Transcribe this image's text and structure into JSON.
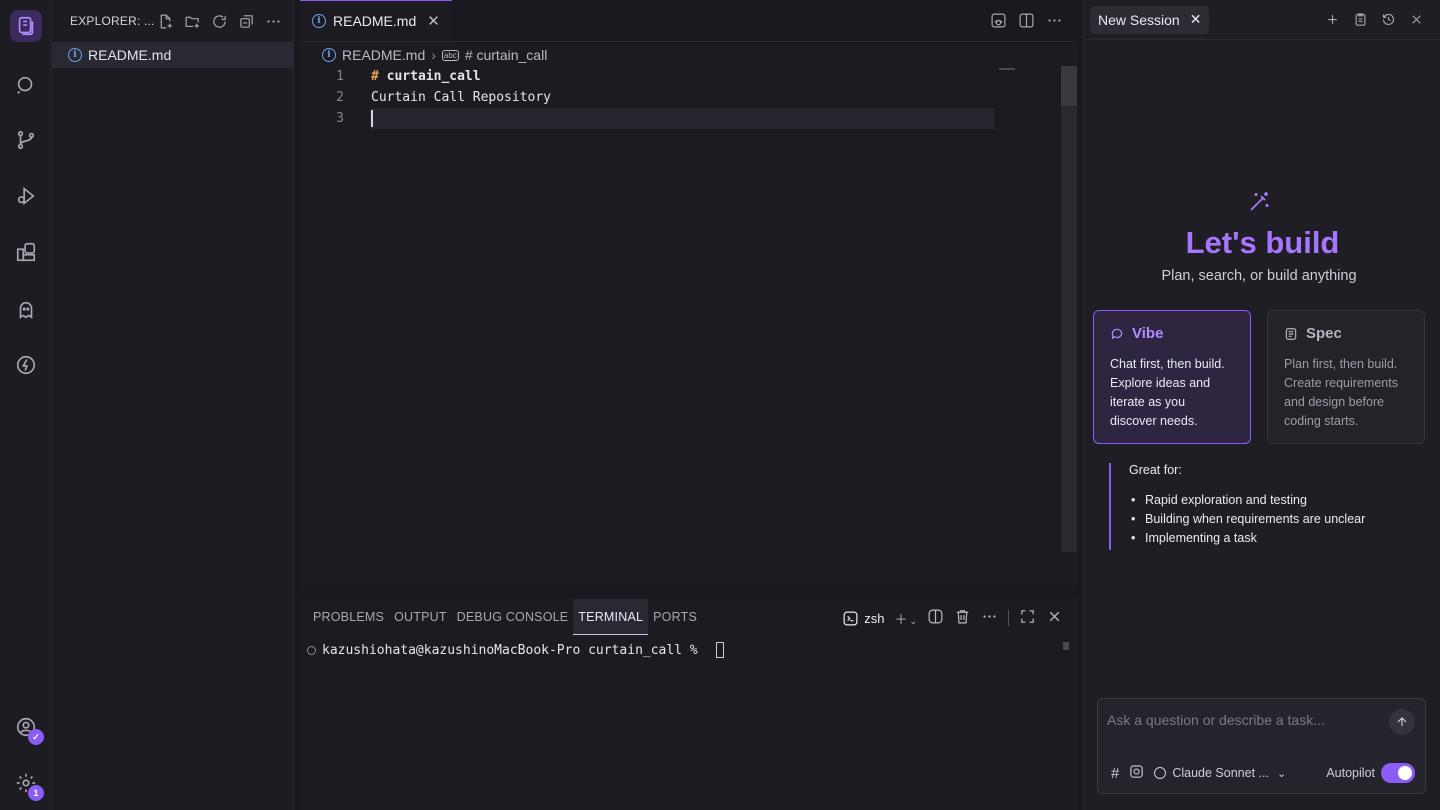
{
  "activity_bar": {
    "items": [
      {
        "name": "logo-icon"
      },
      {
        "name": "search-icon"
      },
      {
        "name": "source-control-icon"
      },
      {
        "name": "run-debug-icon"
      },
      {
        "name": "extensions-icon"
      },
      {
        "name": "ghost-icon"
      },
      {
        "name": "lightning-icon"
      }
    ],
    "settings_badge": "1"
  },
  "explorer": {
    "title": "EXPLORER: ...",
    "files": [
      {
        "name": "README.md"
      }
    ]
  },
  "editor": {
    "tab_label": "README.md",
    "breadcrumb": {
      "file": "README.md",
      "symbol": "# curtain_call"
    },
    "lines": [
      {
        "number": "1",
        "hash": "#",
        "text": " curtain_call"
      },
      {
        "number": "2",
        "text": "Curtain Call Repository"
      },
      {
        "number": "3",
        "text": ""
      }
    ]
  },
  "panel": {
    "tabs": [
      "PROBLEMS",
      "OUTPUT",
      "DEBUG CONSOLE",
      "TERMINAL",
      "PORTS"
    ],
    "active_tab": "TERMINAL",
    "shell": "zsh",
    "prompt": "kazushiohata@kazushinoMacBook-Pro curtain_call % "
  },
  "chat": {
    "tab_label": "New Session",
    "heading": "Let's build",
    "subheading": "Plan, search, or build anything",
    "modes": [
      {
        "title": "Vibe",
        "body": "Chat first, then build. Explore ideas and iterate as you discover needs.",
        "selected": true
      },
      {
        "title": "Spec",
        "body": "Plan first, then build. Create requirements and design before coding starts.",
        "selected": false
      }
    ],
    "great_for": {
      "title": "Great for:",
      "items": [
        "Rapid exploration and testing",
        "Building when requirements are unclear",
        "Implementing a task"
      ]
    },
    "input_placeholder": "Ask a question or describe a task...",
    "model": "Claude Sonnet ...",
    "autopilot_label": "Autopilot",
    "autopilot_on": true
  },
  "colors": {
    "accent": "#8b5cf6",
    "accent_text": "#a875ff",
    "background": "#1a1920"
  }
}
